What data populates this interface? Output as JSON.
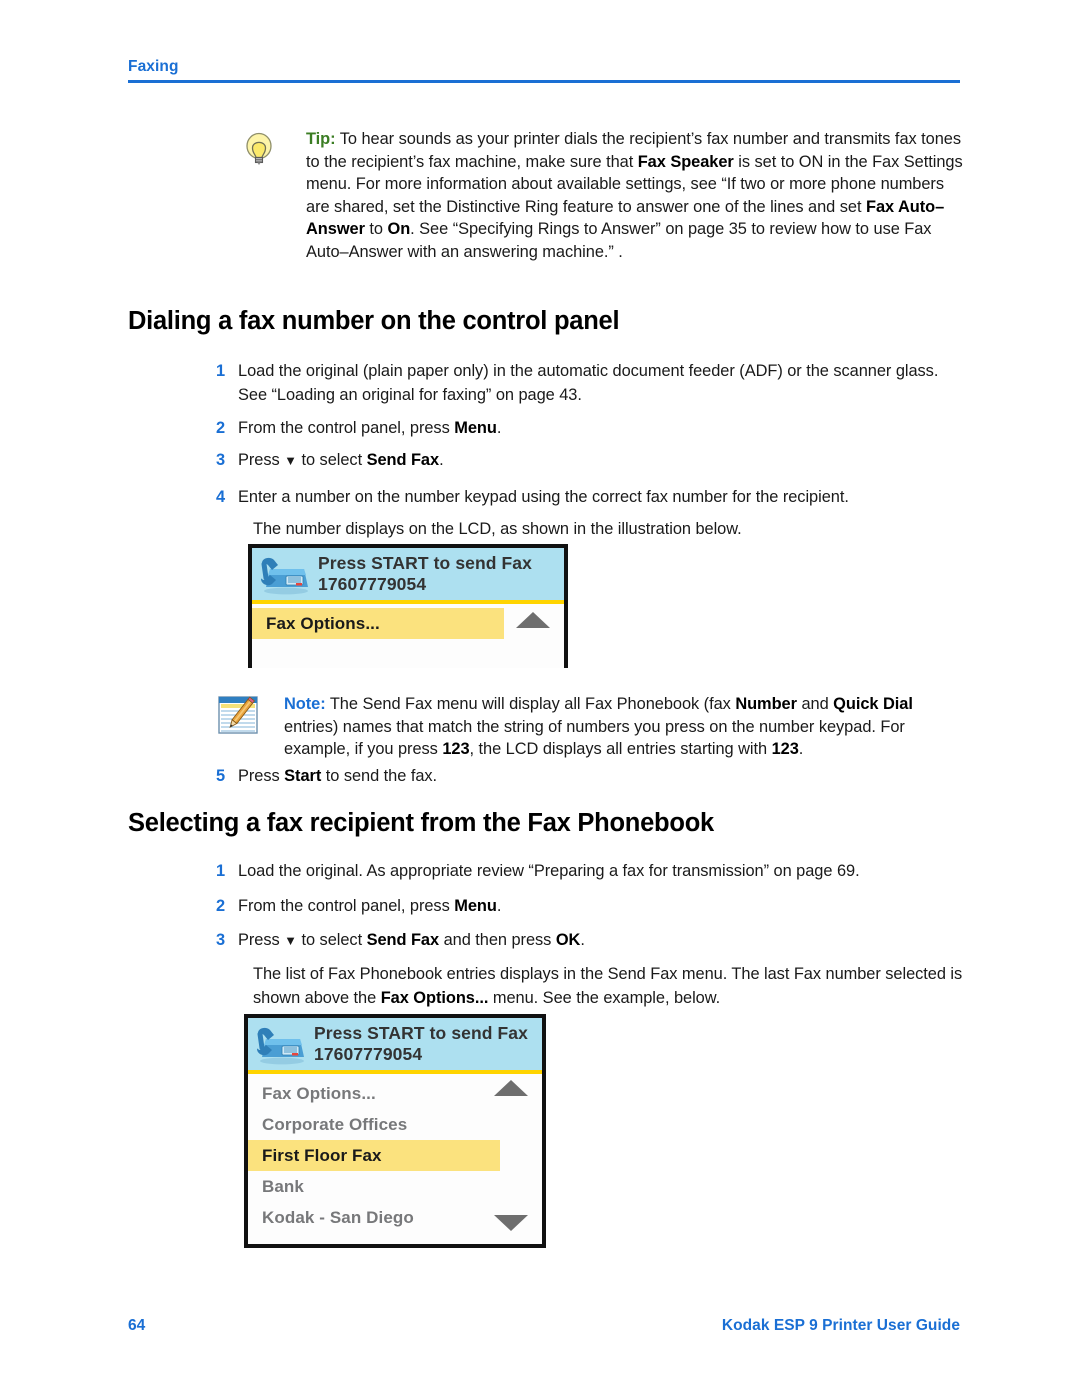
{
  "running_header": {
    "label": "Faxing"
  },
  "tip": {
    "icon": "lightbulb-icon",
    "label": "Tip:",
    "text_1": " To hear sounds as your printer dials the recipient’s fax number and transmits fax tones to the recipient’s fax machine, make sure that ",
    "bold_1": "Fax Speaker",
    "text_2": " is set to ON in the Fax Settings menu. For more information about available settings, see “If two or more phone numbers are shared, set the Distinctive Ring feature to answer one of the lines and set ",
    "bold_2": "Fax Auto–Answer",
    "text_3": " to ",
    "bold_3": "On",
    "text_4": ". See “Specifying Rings to Answer” on page 35 to review how to use Fax Auto–Answer with an answering machine.” ."
  },
  "section_dialing": {
    "title": "Dialing a fax number on the control panel",
    "steps": [
      {
        "num": "1",
        "text_1": "Load the original (plain paper only) in the automatic document feeder (ADF) or the scanner glass. See “Loading an original for faxing” on page 43."
      },
      {
        "num": "2",
        "text_1": "From the control panel, press ",
        "bold_1": "Menu",
        "text_2": "."
      },
      {
        "num": "3",
        "text_1": "Press ",
        "glyph": "▼",
        "text_2": " to select ",
        "bold_1": "Send Fax",
        "text_3": "."
      },
      {
        "num": "4",
        "text_1": "Enter a number on the number keypad using the correct fax number for the recipient."
      },
      {
        "num": "5",
        "text_1": "Press ",
        "bold_1": "Start",
        "text_2": " to send the fax."
      }
    ],
    "paragraph_after_step4": "The number displays on the LCD, as shown in the illustration below."
  },
  "lcd_one": {
    "icon": "fax-machine-icon",
    "header_line_1": "Press START to send Fax",
    "header_line_2": "17607779054",
    "rows": [
      {
        "label": "Fax Options...",
        "highlighted": true
      }
    ],
    "scroll_up_icon": "triangle-up-icon",
    "colors": {
      "header_bg": "#ade0f0",
      "divider": "#ffd400",
      "highlight": "#fbe27e",
      "border": "#111111"
    }
  },
  "note": {
    "icon": "notepad-pencil-icon",
    "label": "Note:",
    "text_1": "  The Send Fax menu will display all Fax Phonebook (fax ",
    "bold_1": "Number",
    "text_2": " and ",
    "bold_2": "Quick Dial",
    "text_3": " entries) names that match the string of numbers you press on the number keypad. For example, if you press ",
    "bold_3": "123",
    "text_4": ", the LCD displays all entries starting with ",
    "bold_4": "123",
    "text_5": "."
  },
  "section_selecting": {
    "title": "Selecting a fax recipient from the Fax Phonebook",
    "steps": [
      {
        "num": "1",
        "text_1": "Load the original. As appropriate review “Preparing a fax for transmission” on page 69."
      },
      {
        "num": "2",
        "text_1": "From the control panel, press ",
        "bold_1": "Menu",
        "text_2": "."
      },
      {
        "num": "3",
        "text_1": "Press ",
        "glyph": "▼",
        "text_2": " to select ",
        "bold_1": "Send Fax",
        "text_3": " and then press ",
        "bold_2": "OK",
        "text_4": "."
      }
    ],
    "paragraph_1": "The list of Fax Phonebook entries displays in the Send Fax menu. The last Fax number selected is shown above the ",
    "paragraph_bold": "Fax Options...",
    "paragraph_2": " menu. See the example, below."
  },
  "lcd_two": {
    "icon": "fax-machine-icon",
    "header_line_1": "Press START to send Fax",
    "header_line_2": "17607779054",
    "rows": [
      {
        "label": "Fax Options...",
        "highlighted": false
      },
      {
        "label": "Corporate Offices",
        "highlighted": false
      },
      {
        "label": "First Floor Fax",
        "highlighted": true
      },
      {
        "label": "Bank",
        "highlighted": false
      },
      {
        "label": "Kodak - San Diego",
        "highlighted": false
      }
    ],
    "scroll_up_icon": "triangle-up-icon",
    "scroll_down_icon": "triangle-down-icon"
  },
  "footer": {
    "page_number": "64",
    "guide_title": "Kodak ESP 9 Printer User Guide"
  }
}
